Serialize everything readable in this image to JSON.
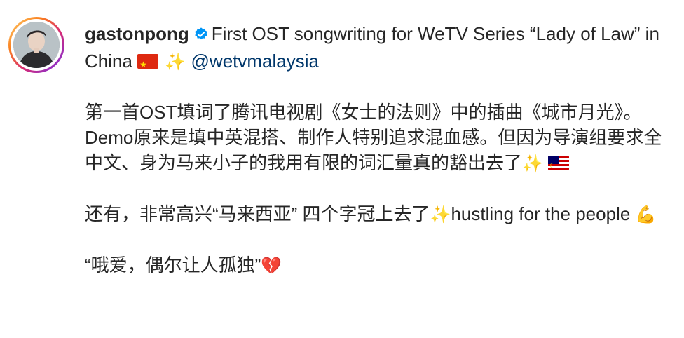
{
  "post": {
    "username": "gastonpong",
    "verified": true,
    "caption_line1_text": "First OST songwriting for WeTV Series “Lady of Law” in China",
    "mention": "@wetvmalaysia",
    "para2": "第一首OST填词了腾讯电视剧《女士的法则》中的插曲《城市月光》。Demo原来是填中英混搭、制作人特别追求混血感。但因为导演组要求全中文、身为马来小子的我用有限的词汇量真的豁出去了",
    "para3": "还有，非常高兴“马来西亚” 四个字冠上去了",
    "para3_tail": "hustling for the people",
    "para4": "“哦爱，偶尔让人孤独”",
    "emoji": {
      "sparkles": "✨",
      "flexed_biceps": "💪",
      "broken_heart": "💔",
      "flag_china": "flag-cn",
      "flag_malaysia": "flag-my"
    }
  },
  "colors": {
    "text": "#262626",
    "mention": "#00376b",
    "verified_badge": "#0095f6"
  }
}
